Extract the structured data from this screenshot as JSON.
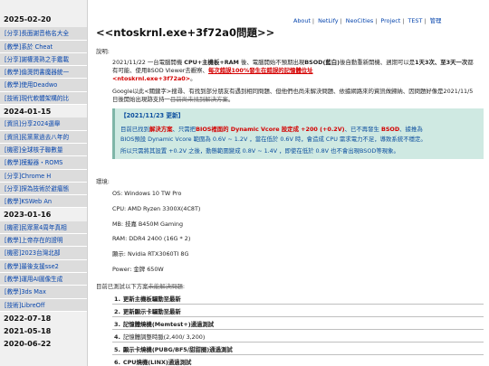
{
  "sidebar": {
    "groups": [
      {
        "date": "2025-02-20",
        "items": [
          "[分享]長面謝音格名大全",
          "[教學]系於 Cheat",
          "[分享]謝權燙熟之手鑑載",
          "[教學]倫燙問書魔器統一",
          "[教學]使用Deadwo",
          "[技術]現代軟體架構的比"
        ]
      },
      {
        "date": "2024-01-15",
        "items": [
          "[資訊]分享2024選舉",
          "[資訊]民黨黨過去八年的",
          "[機密]全球核子聯數量",
          "[教學]模擬器・ROMS",
          "[分享]Chrome H",
          "[分享]探為技術於避瘤態",
          "[教學]KSWeb An"
        ]
      },
      {
        "date": "2023-01-16",
        "items": [
          "[機密]民眾黨4周年真相",
          "[教學]上帝存在的證明",
          "[機密]2023台灣北部",
          "[教學]最後支援sse2",
          "[教學]運用AI圖像生成",
          "[教學]3ds Max",
          "[技術]LibreOff"
        ]
      },
      {
        "date": "2022-07-18",
        "items": []
      },
      {
        "date": "2021-05-18",
        "items": []
      },
      {
        "date": "2020-06-22",
        "items": []
      }
    ]
  },
  "topnav": {
    "links": [
      "About",
      "NetLify",
      "NeoCities",
      "Project",
      "TEST",
      "管理"
    ]
  },
  "page": {
    "title": "<<ntoskrnl.exe+3f72a0問題>>"
  },
  "article": {
    "intro_label": "說明:",
    "para1": {
      "t1": "2021/11/22   一台電腦開機 ",
      "t2": "CPU+主機板+RAM",
      "t3": " 後、電腦開始不預期出現",
      "t4": "BSOD(藍白)",
      "t5": "後自動重新開機、週期可以是",
      "t6": "1天3次、至3天一次",
      "t7": "都有可能、使用BSOD Viewer去觀察、",
      "t8": "每次錯誤100%發生在錯誤的記憶體位址",
      "t9": "<ntoskrnl.exe+3f72a0>",
      "t10": "。"
    },
    "para2": {
      "t1": "Google以此<關鍵字>搜尋、有找到部分朋友有遇到相同問題、但他們也尚未解決問題、依據網路來的資訊做歸納、因問題好像是2021/11/5日後開始出現跡支持一",
      "t2": "目前尚未找到解決方案",
      "t3": "。"
    },
    "update": {
      "header": "【2021/11/23 更新】",
      "l1a": "目前已找到",
      "l1b": "解決方案",
      "l1c": "、只需把",
      "l1d": "BIOS裡面的 Dynamic Vcore 設定成 +200 (+0.2V)",
      "l1e": "、已不再發生 ",
      "l1f": "BSOD",
      "l1g": "、據推為",
      "l2": "BIOS預設 Dynamic Vcore 範圍為 0.6V ~ 1.2V ，當在低於 0.6V 時，會造成 CPU 需求電力不足，導致系統不穩定。",
      "l3": "所以只需將其設置 +0.2V 之後，動態範圍變成 0.8V ~ 1.4V ，即使在低於 0.8V 也不會出現BSOD等現象。"
    },
    "env_label": "環境:",
    "env": [
      "OS: Windows 10 TW Pro",
      "CPU: AMD Ryzen 3300X(4C8T)",
      "MB: 技嘉 B450M Gaming",
      "RAM: DDR4 2400 (16G * 2)",
      "顯示: Nvidia RTX3060TI 8G",
      "Power: 金牌 650W"
    ],
    "test_label": "目前已測試以下方案",
    "test_label_strike": "未能解決問題",
    "test_label_end": ":",
    "tests": [
      {
        "num": "1.",
        "text": "更新主機板驅動至最新",
        "bold": true
      },
      {
        "num": "2.",
        "text": "更新顯示卡驅動至最新",
        "bold": true
      },
      {
        "num": "3.",
        "text": "記憶體燒機(Memtest+)通過測試",
        "bold": true
      },
      {
        "num": "4.",
        "text": "記憶體調整時脈(2,400/ 3,200)",
        "bold": false
      },
      {
        "num": "5.",
        "text": "顯示卡燒機(PUBG/BF5/甜甜圈)通過測試",
        "bold": true
      },
      {
        "num": "6.",
        "text": "CPU燒機(LINX)通過測試",
        "bold": true
      }
    ]
  }
}
